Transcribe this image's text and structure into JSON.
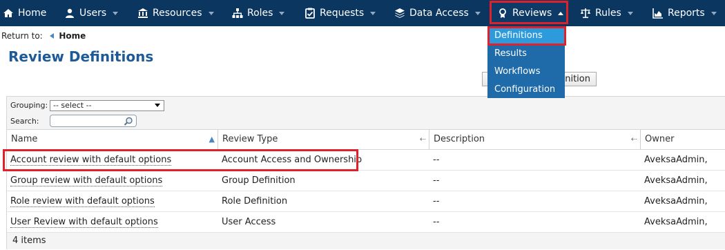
{
  "nav": {
    "home": "Home",
    "users": "Users",
    "resources": "Resources",
    "roles": "Roles",
    "requests": "Requests",
    "data_access": "Data Access",
    "reviews": "Reviews",
    "rules": "Rules",
    "reports": "Reports"
  },
  "reviews_menu": [
    "Definitions",
    "Results",
    "Workflows",
    "Configuration"
  ],
  "breadcrumb": {
    "prefix": "Return to:",
    "home": "Home"
  },
  "page_title": "Review Definitions",
  "new_button_visible_text": "inition",
  "filters": {
    "grouping_label": "Grouping:",
    "grouping_value": "-- select --",
    "search_label": "Search:",
    "search_value": ""
  },
  "columns": [
    "Name",
    "Review Type",
    "Description",
    "Owner"
  ],
  "rows": [
    {
      "name": "Account review with default options",
      "type": "Account Access and Ownership",
      "description": "--",
      "owner": "AveksaAdmin,"
    },
    {
      "name": "Group review with default options",
      "type": "Group Definition",
      "description": "--",
      "owner": "AveksaAdmin,"
    },
    {
      "name": "Role review with default options",
      "type": "Role Definition",
      "description": "--",
      "owner": "AveksaAdmin,"
    },
    {
      "name": "User Review with default options",
      "type": "User Access",
      "description": "--",
      "owner": "AveksaAdmin,"
    }
  ],
  "footer": "4 items",
  "colors": {
    "nav_bg": "#0b3660",
    "menu_bg": "#1f6aa8",
    "menu_active": "#2d9bdb",
    "title": "#1d5a96",
    "highlight": "#e0212b"
  }
}
